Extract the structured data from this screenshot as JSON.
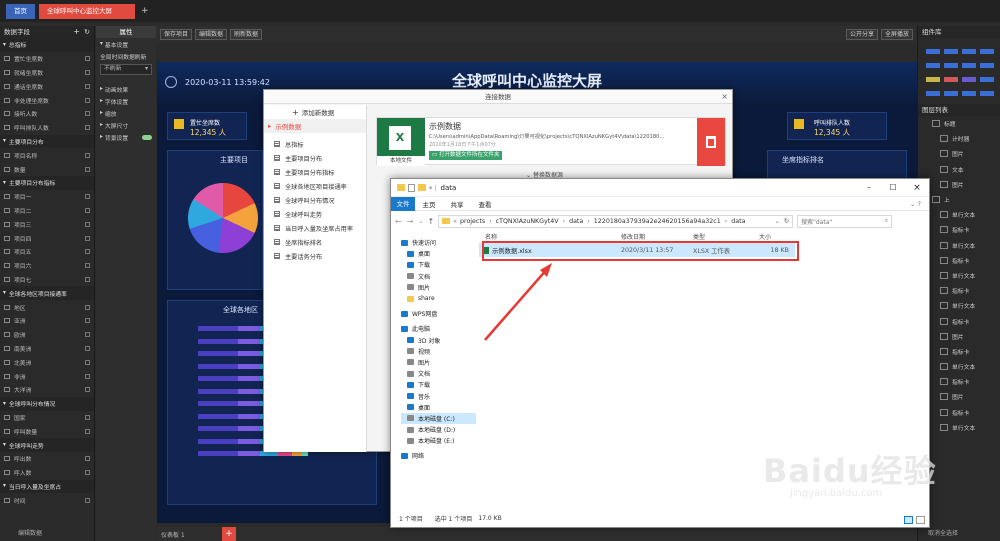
{
  "tabs": {
    "home": "首页",
    "active": "全球呼叫中心监控大屏",
    "add": "+"
  },
  "toolbar": {
    "save": "保存项目",
    "edit": "编辑数据",
    "refresh": "刷新数据",
    "share": "公开分享",
    "fullscreen": "全屏播放"
  },
  "left_panel": {
    "header": "数据字段",
    "groups": [
      {
        "title": "总指标",
        "items": [
          "置忙坐席数",
          "就绪坐席数",
          "通话坐席数",
          "非处理坐席数",
          "接听人数",
          "呼叫排队人数"
        ]
      },
      {
        "title": "主要项目分布",
        "items": [
          "项目名称",
          "数量"
        ]
      },
      {
        "title": "主要项目分布指标",
        "items": [
          "项目一",
          "项目二",
          "项目三",
          "项目四",
          "项目五",
          "项目六",
          "项目七"
        ]
      },
      {
        "title": "全球各地区项目接通率",
        "items": [
          "地区",
          "亚洲",
          "欧洲",
          "南美洲",
          "北美洲",
          "非洲",
          "大洋洲"
        ]
      },
      {
        "title": "全球呼叫分布情况",
        "items": [
          "国家",
          "呼叫数量"
        ]
      },
      {
        "title": "全球呼叫走势",
        "items": [
          "呼出数",
          "呼入数"
        ]
      },
      {
        "title": "当日呼入量及坐席占",
        "items": [
          "时间"
        ]
      }
    ],
    "footer": "编辑数据"
  },
  "prop_panel": {
    "header": "属性",
    "sections": [
      "基本设置",
      "全局时间数据刷新"
    ],
    "select": "不刷新",
    "more": [
      "动画效果",
      "字体设置",
      "缩放",
      "大屏尺寸",
      "背景设置"
    ]
  },
  "canvas": {
    "datetime": "2020-03-11 13:59:42",
    "title": "全球呼叫中心监控大屏",
    "kpi_left_label": "置忙坐席数",
    "kpi_left_value": "12,345 人",
    "kpi_right_label": "呼叫排队人数",
    "kpi_right_value": "12,345 人",
    "panel1": "主要项目",
    "panel2": "全球各地区",
    "panel3": "坐席指标排名"
  },
  "right_panel": {
    "header": "组件库",
    "layers_header": "图层列表",
    "layers": [
      "标题",
      "计时器",
      "图片",
      "文本",
      "图片",
      "上",
      "单行文本",
      "指标卡",
      "单行文本",
      "指标卡",
      "单行文本",
      "指标卡",
      "单行文本",
      "指标卡",
      "图片",
      "指标卡",
      "单行文本",
      "指标卡",
      "图片",
      "指标卡",
      "单行文本"
    ],
    "footer": "取消全选择"
  },
  "dialog": {
    "title": "连接数据",
    "add_label": "添加新数据",
    "dataset": "示例数据",
    "items": [
      "总指标",
      "主要项目分布",
      "主要项目分布指标",
      "全球各地区项目接通率",
      "全球呼叫分布情况",
      "全球呼叫走势",
      "当日呼入量及坐席占用率",
      "坐席指标排名",
      "主要话务分布"
    ],
    "card_title": "示例数据",
    "card_path": "C:\\Users\\admin\\AppData\\Roaming\\灯果可视化\\projects\\cTQNXlAzuNKGyt4V\\data\\1220180...",
    "card_time": "2020年1月18日下午1点07分",
    "card_file_label": "本地文件",
    "open_folder": "打开数据文件所在文件夹",
    "replace": "替换数据源",
    "bottom_tab": "仪表板 1"
  },
  "explorer": {
    "title": "data",
    "ribbon": [
      "文件",
      "主页",
      "共享",
      "查看"
    ],
    "path": [
      "projects",
      "cTQNXlAzuNKGyt4V",
      "data",
      "1220180a37939a2e24620156a94a32c1",
      "data"
    ],
    "search_placeholder": "搜索\"data\"",
    "columns": [
      "名称",
      "修改日期",
      "类型",
      "大小"
    ],
    "file": {
      "name": "示例数据.xlsx",
      "date": "2020/3/11 13:57",
      "type": "XLSX 工作表",
      "size": "18 KB"
    },
    "nav": [
      {
        "label": "快速访问",
        "kind": "star"
      },
      {
        "label": "桌面",
        "kind": "desk"
      },
      {
        "label": "下载",
        "kind": "down"
      },
      {
        "label": "文档",
        "kind": "doc"
      },
      {
        "label": "图片",
        "kind": "pic"
      },
      {
        "label": "share",
        "kind": "folder"
      },
      {
        "label": "WPS网盘",
        "kind": "cloud"
      },
      {
        "label": "此电脑",
        "kind": "pc"
      },
      {
        "label": "3D 对象",
        "kind": "3d"
      },
      {
        "label": "视频",
        "kind": "vid"
      },
      {
        "label": "图片",
        "kind": "pic"
      },
      {
        "label": "文档",
        "kind": "doc"
      },
      {
        "label": "下载",
        "kind": "down"
      },
      {
        "label": "音乐",
        "kind": "music"
      },
      {
        "label": "桌面",
        "kind": "desk"
      },
      {
        "label": "本地磁盘 (C:)",
        "kind": "drive"
      },
      {
        "label": "本地磁盘 (D:)",
        "kind": "drive"
      },
      {
        "label": "本地磁盘 (E:)",
        "kind": "drive"
      },
      {
        "label": "网络",
        "kind": "net"
      }
    ],
    "status_count": "1 个项目",
    "status_selected": "选中 1 个项目",
    "status_size": "17.0 KB"
  },
  "watermark": {
    "brand": "Baidu经验",
    "url": "jingyan.baidu.com"
  },
  "colors": {
    "accent_red": "#e8483f",
    "excel_green": "#1d7a45",
    "selection": "#cce8ff",
    "highlight": "#e53935"
  }
}
